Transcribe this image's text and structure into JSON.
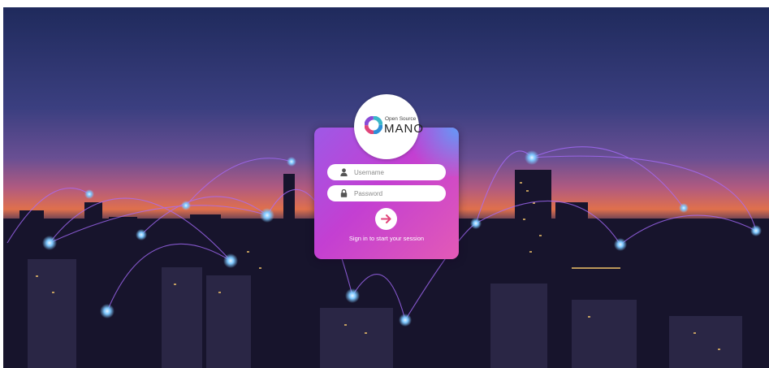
{
  "logo": {
    "small_text": "Open Source",
    "big_text": "MANO"
  },
  "login": {
    "username_placeholder": "Username",
    "password_placeholder": "Password",
    "session_text": "Sign in to start your session"
  },
  "icons": {
    "user": "user-icon",
    "lock": "lock-icon",
    "submit": "arrow-right-icon"
  },
  "colors": {
    "card_start": "#9e59e6",
    "card_end": "#e35ab6",
    "submit_arrow": "#e0457a"
  }
}
